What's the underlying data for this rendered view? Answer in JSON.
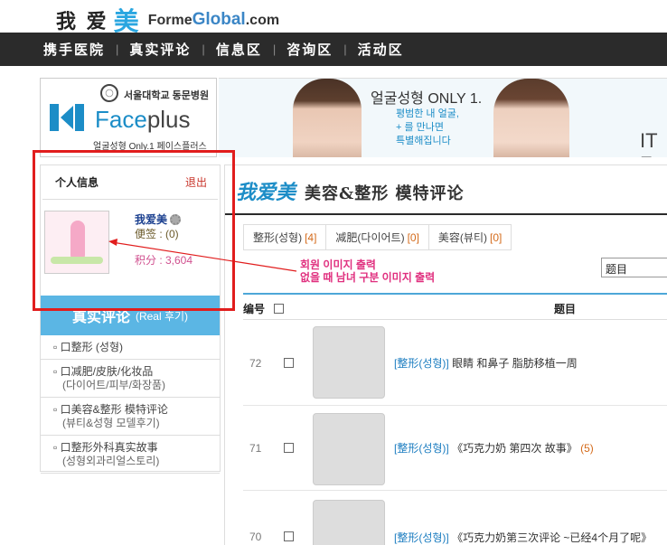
{
  "header": {
    "logo_cn": "我 爱",
    "logo_mei": "美",
    "logo_brand_prefix": "Forme",
    "logo_brand_main": "Global",
    "logo_brand_suffix": ".com"
  },
  "nav": {
    "items": [
      "携手医院",
      "真实评论",
      "信息区",
      "咨询区",
      "活动区"
    ],
    "separator": "|"
  },
  "banner": {
    "hospital_name": "서울대학교 동문병원",
    "brand_face": "Face",
    "brand_plus": "plus",
    "brand_sub": "얼굴성형 Only.1 페이스플러스",
    "ad_line1": "얼굴성형 ONLY 1.",
    "ad_line2": "평범한 내 얼굴,",
    "ad_line3": "+ 를 만나면",
    "ad_line4": "특별해집니다",
    "ad_right": "IT F"
  },
  "sidebar": {
    "title": "个人信息",
    "logout": "退出",
    "username": "我爱美",
    "memo": "便签 : (0)",
    "points": "积分 : 3,604",
    "real_review_cn": "真实评论",
    "real_review_en": "(Real 후기)",
    "menu": [
      {
        "label": "▫ 口整形 (성형)",
        "sub": ""
      },
      {
        "label": "▫ 口减肥/皮肤/化妆品",
        "sub": "(다이어트/피부/화장품)"
      },
      {
        "label": "▫ 口美容&整形 模特评论",
        "sub": "(뷰티&성형 모델후기)"
      },
      {
        "label": "▫ 口整形外科真实故事",
        "sub": "(성형외과리얼스토리)"
      }
    ]
  },
  "main": {
    "title_cn": "我爱美",
    "title_sub": "美容&整形  模特评论",
    "tabs": [
      {
        "label": "整形(성형)",
        "count": "[4]"
      },
      {
        "label": "减肥(다이어트)",
        "count": "[0]"
      },
      {
        "label": "美容(뷰티)",
        "count": "[0]"
      }
    ],
    "search_select": "题目",
    "table_header": {
      "num": "编号",
      "subject": "题目"
    },
    "rows": [
      {
        "no": "72",
        "category": "[整形(성형)]",
        "title": " 眼睛 和鼻子 脂肪移植一周",
        "comments": ""
      },
      {
        "no": "71",
        "category": "[整形(성형)]",
        "title": " 《巧克力奶 第四次 故事》",
        "comments": "(5)"
      },
      {
        "no": "70",
        "category": "[整形(성형)]",
        "title": " 《巧克力奶第三次评论 ~已经4个月了呢》",
        "comments": ""
      }
    ]
  },
  "annotation": {
    "line1": "회원 이미지 출력",
    "line2": "없을 때 남녀 구분 이미지 출력",
    "color": "#e11d1d"
  }
}
